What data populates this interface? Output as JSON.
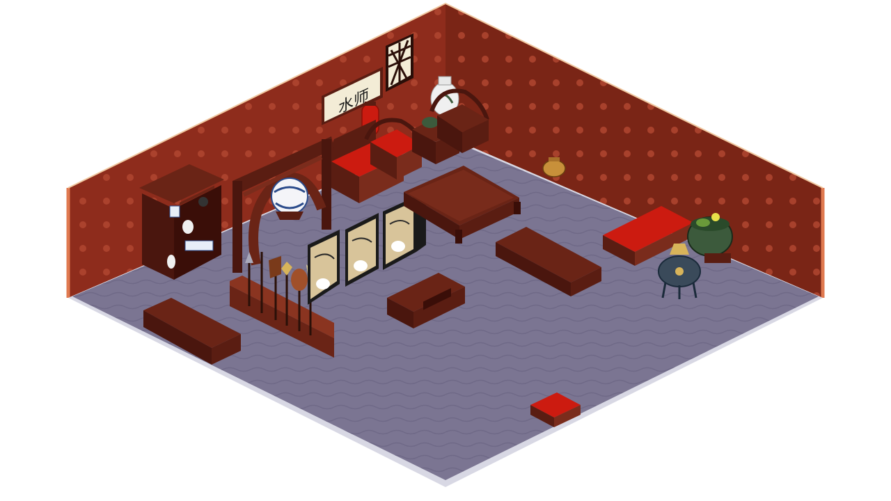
{
  "scene": {
    "colors": {
      "wall_left": "#8e2c1c",
      "wall_right": "#7a2516",
      "wall_dot": "#b04530",
      "wall_edge_trim": "#e07a50",
      "floor": "#7b7592",
      "floor_dark": "#6a6482",
      "floor_edge": "#d8d8e4",
      "wood": "#5a1d12",
      "wood_light": "#7a2c1c",
      "cushion": "#cc1b10",
      "gold": "#d8b45a",
      "scroll_bg": "#f3ecd6",
      "jade": "#3c5a3c",
      "bronze": "#3a4a5a"
    },
    "scroll": {
      "text": "水师"
    }
  }
}
